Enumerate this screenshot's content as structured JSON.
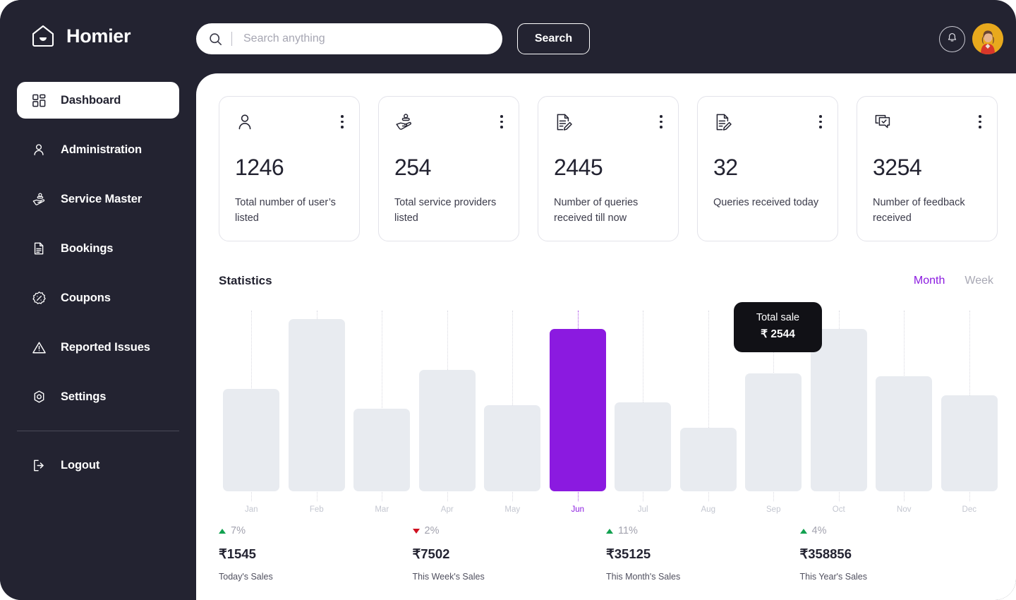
{
  "brand": {
    "name": "Homier",
    "logo_icon": "home-logo-icon"
  },
  "sidebar": {
    "items": [
      {
        "label": "Dashboard",
        "icon": "grid-icon",
        "active": true
      },
      {
        "label": "Administration",
        "icon": "user-icon",
        "active": false
      },
      {
        "label": "Service Master",
        "icon": "hand-service-icon",
        "active": false
      },
      {
        "label": "Bookings",
        "icon": "document-icon",
        "active": false
      },
      {
        "label": "Coupons",
        "icon": "percent-badge-icon",
        "active": false
      },
      {
        "label": "Reported Issues",
        "icon": "warning-triangle-icon",
        "active": false
      },
      {
        "label": "Settings",
        "icon": "gear-icon",
        "active": false
      }
    ],
    "logout": {
      "label": "Logout",
      "icon": "logout-icon"
    }
  },
  "header": {
    "search": {
      "placeholder": "Search anything",
      "value": "",
      "icon": "search-icon",
      "button_label": "Search"
    },
    "notification_icon": "bell-icon",
    "avatar_icon": "user-avatar"
  },
  "cards": [
    {
      "icon": "user-outline-icon",
      "value": "1246",
      "label": "Total number of user’s listed",
      "menu_icon": "kebab-menu-icon"
    },
    {
      "icon": "hand-service-icon",
      "value": "254",
      "label": "Total service providers listed",
      "menu_icon": "kebab-menu-icon"
    },
    {
      "icon": "document-edit-icon",
      "value": "2445",
      "label": "Number of queries received till now",
      "menu_icon": "kebab-menu-icon"
    },
    {
      "icon": "document-edit-icon",
      "value": "32",
      "label": "Queries received today",
      "menu_icon": "kebab-menu-icon"
    },
    {
      "icon": "chat-check-icon",
      "value": "3254",
      "label": "Number of feedback received",
      "menu_icon": "kebab-menu-icon"
    }
  ],
  "statistics": {
    "title": "Statistics",
    "tabs": [
      {
        "label": "Month",
        "active": true
      },
      {
        "label": "Week",
        "active": false
      }
    ],
    "tooltip": {
      "title": "Total sale",
      "value": "₹ 2544"
    }
  },
  "chart_data": {
    "type": "bar",
    "title": "Statistics",
    "xlabel": "",
    "ylabel": "",
    "grid": true,
    "legend": false,
    "categories": [
      "Jan",
      "Feb",
      "Mar",
      "Apr",
      "May",
      "Jun",
      "Jul",
      "Aug",
      "Sep",
      "Oct",
      "Nov",
      "Dec"
    ],
    "values": [
      1600,
      2700,
      1300,
      1900,
      1350,
      2544,
      1400,
      1000,
      1850,
      2550,
      1800,
      1500
    ],
    "ylim": [
      0,
      2900
    ],
    "highlight_index": 5,
    "highlight_color": "#8b1ae0",
    "bar_color": "#e8ebf0"
  },
  "sales": [
    {
      "delta": "7%",
      "direction": "up",
      "amount": "₹1545",
      "label": "Today's Sales"
    },
    {
      "delta": "2%",
      "direction": "down",
      "amount": "₹7502",
      "label": "This Week's Sales"
    },
    {
      "delta": "11%",
      "direction": "up",
      "amount": "₹35125",
      "label": "This Month's Sales"
    },
    {
      "delta": "4%",
      "direction": "up",
      "amount": "₹358856",
      "label": "This Year's Sales"
    }
  ],
  "colors": {
    "sidebar_bg": "#232331",
    "accent": "#8b1ae0",
    "up": "#12a150",
    "down": "#cf1020",
    "bar": "#e8ebf0"
  }
}
